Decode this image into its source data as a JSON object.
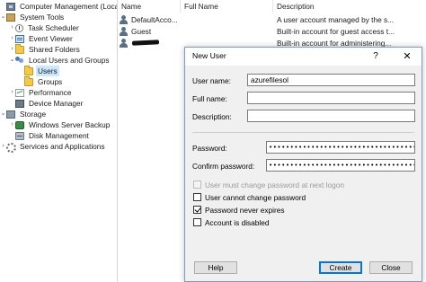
{
  "tree": [
    {
      "label": "Computer Management (Local",
      "icon": "computer-management-icon",
      "chevron": ""
    },
    {
      "label": "System Tools",
      "icon": "toolbox-icon",
      "chevron": "⌄"
    },
    {
      "label": "Task Scheduler",
      "icon": "clock-icon",
      "chevron": "›"
    },
    {
      "label": "Event Viewer",
      "icon": "event-log-icon",
      "chevron": "›"
    },
    {
      "label": "Shared Folders",
      "icon": "folder-icon",
      "chevron": "›"
    },
    {
      "label": "Local Users and Groups",
      "icon": "users-icon",
      "chevron": "⌄"
    },
    {
      "label": "Users",
      "icon": "folder-icon",
      "chevron": ""
    },
    {
      "label": "Groups",
      "icon": "folder-icon",
      "chevron": ""
    },
    {
      "label": "Performance",
      "icon": "performance-icon",
      "chevron": "›"
    },
    {
      "label": "Device Manager",
      "icon": "device-icon",
      "chevron": ""
    },
    {
      "label": "Storage",
      "icon": "storage-icon",
      "chevron": "⌄"
    },
    {
      "label": "Windows Server Backup",
      "icon": "backup-icon",
      "chevron": "›"
    },
    {
      "label": "Disk Management",
      "icon": "disk-icon",
      "chevron": ""
    },
    {
      "label": "Services and Applications",
      "icon": "services-icon",
      "chevron": "›"
    }
  ],
  "list": {
    "columns": [
      "Name",
      "Full Name",
      "Description"
    ],
    "rows": [
      {
        "name": "DefaultAcco...",
        "full_name": "",
        "description": "A user account managed by the s..."
      },
      {
        "name": "Guest",
        "full_name": "",
        "description": "Built-in account for guest access t..."
      },
      {
        "name": "",
        "full_name": "",
        "description": "Built-in account for administering..."
      }
    ]
  },
  "dialog": {
    "title": "New User",
    "help_glyph": "?",
    "close_glyph": "✕",
    "username_label": "User name:",
    "username_value": "azurefilesol",
    "fullname_label": "Full name:",
    "fullname_value": "",
    "description_label": "Description:",
    "description_value": "",
    "password_label": "Password:",
    "password_value": "••••••••••••••••••••••••••••••••••••",
    "confirm_label": "Confirm password:",
    "confirm_value": "••••••••••••••••••••••••••••••••••••",
    "checkboxes": [
      {
        "label": "User must change password at next logon",
        "checked": false,
        "disabled": true
      },
      {
        "label": "User cannot change password",
        "checked": false,
        "disabled": false
      },
      {
        "label": "Password never expires",
        "checked": true,
        "disabled": false
      },
      {
        "label": "Account is disabled",
        "checked": false,
        "disabled": false
      }
    ],
    "help_button": "Help",
    "create_button": "Create",
    "close_button": "Close"
  },
  "colors": {
    "selection": "#cce8ff",
    "dialog_border": "#7a9cc6",
    "primary_button_border": "#0078d7"
  }
}
